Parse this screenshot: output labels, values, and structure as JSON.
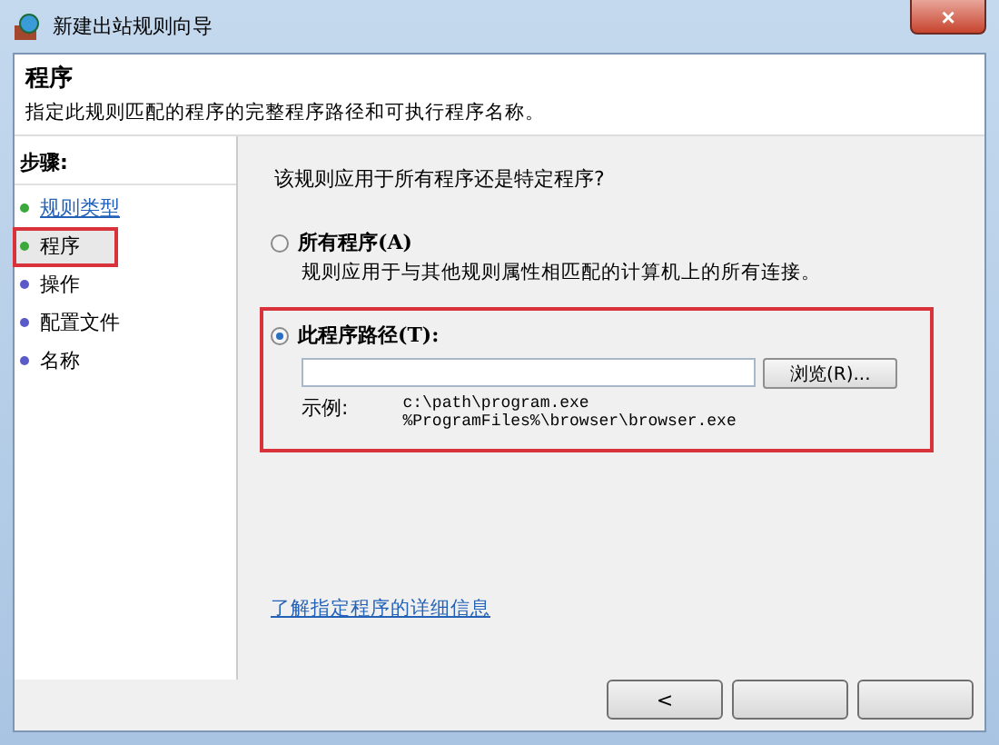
{
  "window": {
    "title": "新建出站规则向导",
    "close": "×"
  },
  "header": {
    "title": "程序",
    "description": "指定此规则匹配的程序的完整程序路径和可执行程序名称。"
  },
  "steps": {
    "heading": "步骤:",
    "items": [
      {
        "label": "规则类型",
        "selected": false,
        "link": true,
        "color": "#3aa83a"
      },
      {
        "label": "程序",
        "selected": true,
        "link": false,
        "color": "#3aa83a",
        "highlighted": true
      },
      {
        "label": "操作",
        "selected": false,
        "link": false,
        "color": "#5a5ac8"
      },
      {
        "label": "配置文件",
        "selected": false,
        "link": false,
        "color": "#5a5ac8"
      },
      {
        "label": "名称",
        "selected": false,
        "link": false,
        "color": "#5a5ac8"
      }
    ]
  },
  "question": "该规则应用于所有程序还是特定程序?",
  "options": [
    {
      "label": "所有程序(A)",
      "description": "规则应用于与其他规则属性相匹配的计算机上的所有连接。",
      "selected": false,
      "highlighted": false
    },
    {
      "label": "此程序路径(T):",
      "selected": true,
      "highlighted": true,
      "path": {
        "browse": "浏览(R)..."
      },
      "example_label": "示例:",
      "examples": [
        "c:\\path\\program.exe",
        "%ProgramFiles%\\browser\\browser.exe"
      ]
    }
  ],
  "link": "了解指定程序的详细信息",
  "buttons": [
    {
      "kind": "text",
      "label": "<"
    },
    {
      "kind": "blank"
    },
    {
      "kind": "blank"
    }
  ]
}
